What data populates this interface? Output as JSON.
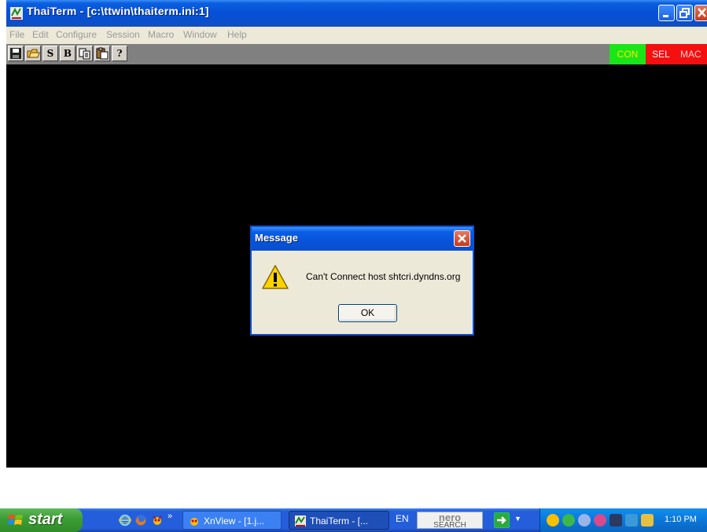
{
  "window": {
    "title": "ThaiTerm - [c:\\ttwin\\thaiterm.ini:1]",
    "app_icon": "thaiterm-icon"
  },
  "menu": [
    "File",
    "Edit",
    "Configure",
    "Session",
    "Macro",
    "Window",
    "Help"
  ],
  "toolbar": {
    "buttons": [
      {
        "name": "save-icon",
        "label": ""
      },
      {
        "name": "open-folder-icon",
        "label": ""
      },
      {
        "name": "s-button",
        "label": "S"
      },
      {
        "name": "b-button",
        "label": "B"
      },
      {
        "name": "copy-icon",
        "label": ""
      },
      {
        "name": "paste-icon",
        "label": ""
      },
      {
        "name": "help-icon",
        "label": "?"
      }
    ],
    "status": {
      "con": "CON",
      "sel": "SEL",
      "mac": "MAC"
    }
  },
  "dialog": {
    "title": "Message",
    "message": "Can't Connect host shtcri.dyndns.org",
    "ok_label": "OK",
    "icon": "warning-icon"
  },
  "taskbar": {
    "start_label": "start",
    "quick_launch": [
      "ie-icon",
      "firefox-icon",
      "xnview-icon"
    ],
    "tasks": [
      {
        "label": "XnView - [1.j...",
        "icon": "xnview-icon"
      },
      {
        "label": "ThaiTerm - [...",
        "icon": "thaiterm-icon"
      }
    ],
    "language": "EN",
    "nero": {
      "brand": "nero",
      "sub": "SEARCH"
    },
    "clock": "1:10 PM"
  },
  "colors": {
    "xp_blue": "#0a5fe0",
    "terminal_bg": "#000000",
    "con_green": "#19e619",
    "status_red": "#f50f0f",
    "start_green": "#3c9c34"
  }
}
